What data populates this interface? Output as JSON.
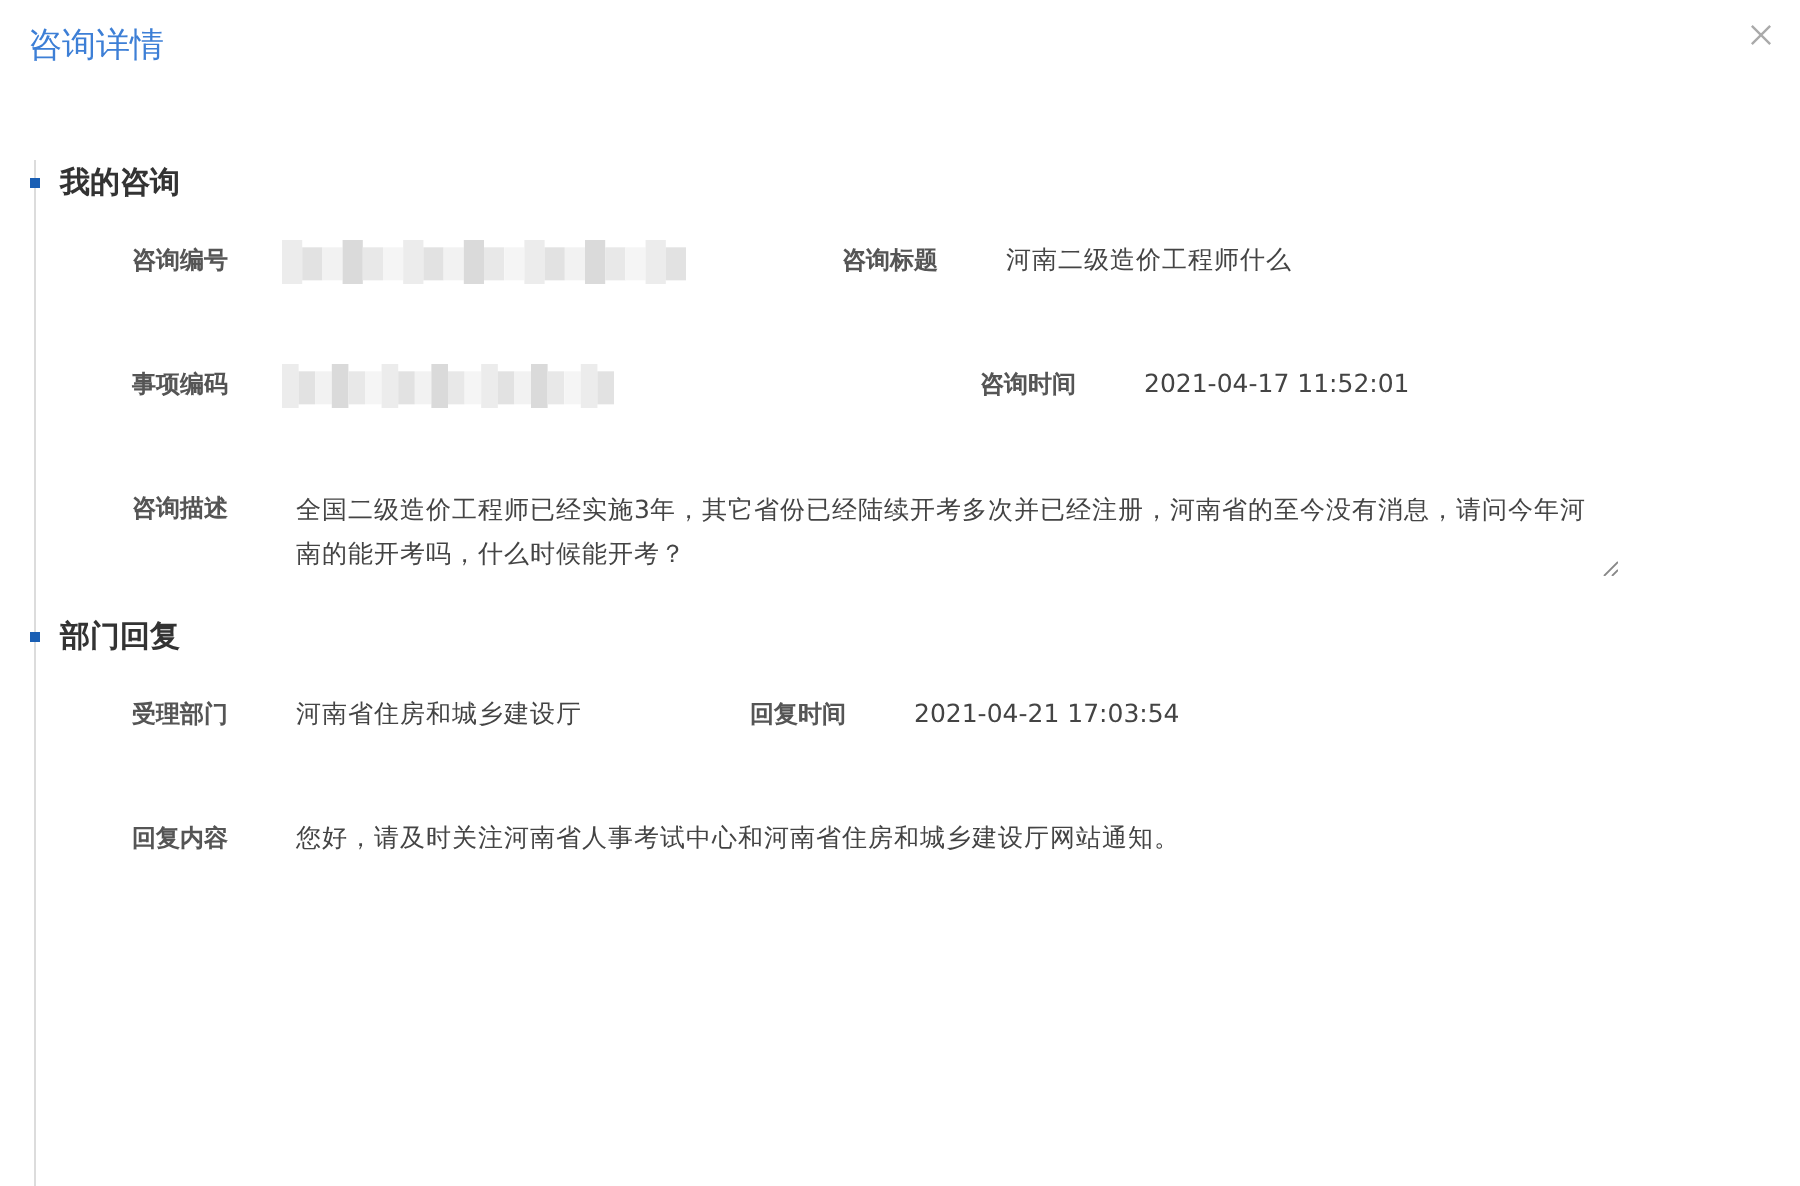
{
  "dialog": {
    "title": "咨询详情"
  },
  "sections": [
    {
      "heading": "我的咨询",
      "rows": [
        {
          "kind": "fields",
          "fields": [
            {
              "label": "咨询编号",
              "redacted": true
            },
            {
              "label": "咨询标题",
              "value": "河南二级造价工程师什么"
            }
          ]
        },
        {
          "kind": "fields",
          "fields": [
            {
              "label": "事项编码",
              "redacted": true
            },
            {
              "label": "咨询时间",
              "value": "2021-04-17 11:52:01"
            }
          ]
        },
        {
          "kind": "textarea",
          "fields": [
            {
              "label": "咨询描述",
              "value": "全国二级造价工程师已经实施3年，其它省份已经陆续开考多次并已经注册，河南省的至今没有消息，请问今年河南的能开考吗，什么时候能开考？"
            }
          ]
        }
      ]
    },
    {
      "heading": "部门回复",
      "rows": [
        {
          "kind": "fields",
          "fields": [
            {
              "label": "受理部门",
              "value": "河南省住房和城乡建设厅"
            },
            {
              "label": "回复时间",
              "value": "2021-04-21 17:03:54"
            }
          ]
        },
        {
          "kind": "fields",
          "fields": [
            {
              "label": "回复内容",
              "value": "您好，请及时关注河南省人事考试中心和河南省住房和城乡建设厅网站通知。"
            }
          ]
        }
      ]
    }
  ]
}
